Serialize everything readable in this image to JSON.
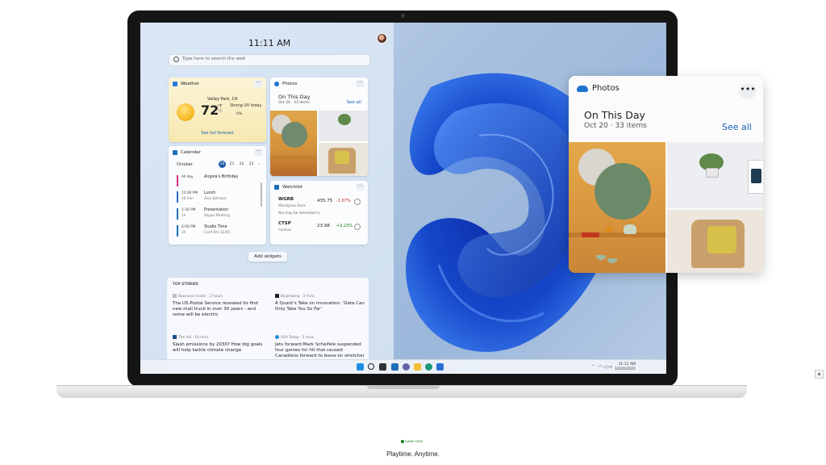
{
  "clock": "11:11 AM",
  "search": {
    "placeholder": "Type here to search the web"
  },
  "weather": {
    "title": "Weather",
    "location": "Valley Park, CA",
    "temperature": "72",
    "unit_f": "°F",
    "unit_c": "°C",
    "condition": "Strong UV today",
    "rain": "0%",
    "forecast_link": "See full forecast"
  },
  "photos_small": {
    "title": "Photos",
    "subtitle": "On This Day",
    "date": "Oct 20 · 33 items",
    "see_all": "See all"
  },
  "calendar": {
    "title": "Calendar",
    "month": "October",
    "days": [
      "20",
      "21",
      "22",
      "23"
    ],
    "events": [
      {
        "t1": "All day",
        "t2": "",
        "name": "Angela's Birthday",
        "detail": "",
        "color": "#d63384"
      },
      {
        "t1": "12:00 PM",
        "t2": "30 min",
        "name": "Lunch",
        "detail": "Alex Johnson",
        "color": "#1f6fb8"
      },
      {
        "t1": "1:30 PM",
        "t2": "1h",
        "name": "Presentation",
        "detail": "Skype Meeting",
        "color": "#1f6fb8"
      },
      {
        "t1": "6:00 PM",
        "t2": "3h",
        "name": "Studio Time",
        "detail": "Conf Rm 32/35",
        "color": "#1f6fb8"
      }
    ]
  },
  "watchlist": {
    "title": "Watchlist",
    "stocks": [
      {
        "symbol": "WGRB",
        "name": "Woodgrove Bank",
        "price": "435.75",
        "change": "-1.67%",
        "color": "#c42b1c"
      },
      {
        "symbol": "CTSP",
        "name": "Contoso",
        "price": "23.98",
        "change": "+2.23%",
        "color": "#107c10"
      }
    ],
    "interest_text": "You may be interested in"
  },
  "add_widgets": "Add widgets",
  "news": {
    "header": "TOP STORIES",
    "stories": [
      {
        "source": "Business Insider · 2 hours",
        "headline": "The US Postal Service revealed its first new mail truck in over 30 years - and some will be electric",
        "color": "#bfbfbf"
      },
      {
        "source": "Bloomberg · 3 mins",
        "headline": "A Quant's Take on Innovation: 'Data Can Only Take You So Far'",
        "color": "#222222"
      },
      {
        "source": "The Hill · 18 mins",
        "headline": "Slash emissions by 2030? How big goals will help tackle climate change",
        "color": "#1f4e8c"
      },
      {
        "source": "USA Today · 5 mins",
        "headline": "Jets forward Mark Scheifele suspended four games for hit that caused Canadiens forward to leave on stretcher",
        "color": "#1f8fd6"
      }
    ]
  },
  "taskbar": {
    "icons": [
      "windows-logo",
      "search-icon",
      "task-view-icon",
      "widgets-icon",
      "chat-icon",
      "file-explorer-icon",
      "edge-icon",
      "store-icon"
    ],
    "time": "11:11 AM",
    "date": "10/20/2021"
  },
  "photos_card": {
    "title": "Photos",
    "more": "•••",
    "subtitle": "On This Day",
    "date": "Oct 20 · 33 items",
    "see_all": "See all"
  },
  "footer": {
    "badge": "GAME PASS",
    "tagline": "Playtime. Anytime."
  },
  "colors": {
    "accent": "#1a5fb4",
    "bloom": "#1547c9"
  }
}
